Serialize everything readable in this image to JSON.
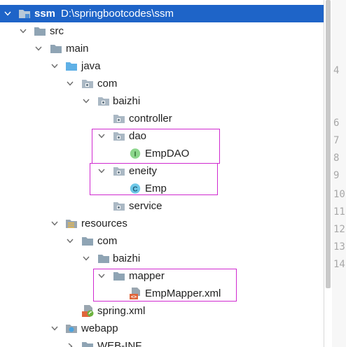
{
  "project_tree": {
    "nodes": [
      {
        "label": "ssm",
        "path": "D:\\springbootcodes\\ssm",
        "icon": "module-folder-icon",
        "expanded": true,
        "selected": true
      },
      {
        "label": "src",
        "icon": "folder-icon",
        "expanded": true
      },
      {
        "label": "main",
        "icon": "folder-icon",
        "expanded": true
      },
      {
        "label": "java",
        "icon": "source-root-folder-icon",
        "expanded": true
      },
      {
        "label": "com",
        "icon": "package-icon",
        "expanded": true
      },
      {
        "label": "baizhi",
        "icon": "package-icon",
        "expanded": true
      },
      {
        "label": "controller",
        "icon": "package-icon"
      },
      {
        "label": "dao",
        "icon": "package-icon",
        "expanded": true
      },
      {
        "label": "EmpDAO",
        "icon": "interface-icon",
        "icon_letter": "I"
      },
      {
        "label": "eneity",
        "icon": "package-icon",
        "expanded": true
      },
      {
        "label": "Emp",
        "icon": "class-icon",
        "icon_letter": "C"
      },
      {
        "label": "service",
        "icon": "package-icon"
      },
      {
        "label": "resources",
        "icon": "resources-root-folder-icon",
        "expanded": true
      },
      {
        "label": "com",
        "icon": "folder-icon",
        "expanded": true
      },
      {
        "label": "baizhi",
        "icon": "folder-icon",
        "expanded": true
      },
      {
        "label": "mapper",
        "icon": "folder-icon",
        "expanded": true
      },
      {
        "label": "EmpMapper.xml",
        "icon": "xml-file-icon"
      },
      {
        "label": "spring.xml",
        "icon": "spring-xml-file-icon"
      },
      {
        "label": "webapp",
        "icon": "web-folder-icon",
        "expanded": true
      },
      {
        "label": "WEB-INF",
        "icon": "folder-icon",
        "expanded": false
      }
    ]
  },
  "gutter": {
    "line_numbers": [
      "4",
      "6",
      "7",
      "8",
      "9",
      "10",
      "11",
      "12",
      "13",
      "14"
    ]
  },
  "colors": {
    "selection": "#1e64c8",
    "highlight_box": "#d02ad0",
    "folder": "#8fa4b4",
    "source_root": "#5fb0e6",
    "interface_icon": "#8cd68c",
    "class_icon": "#6ec8e8"
  }
}
